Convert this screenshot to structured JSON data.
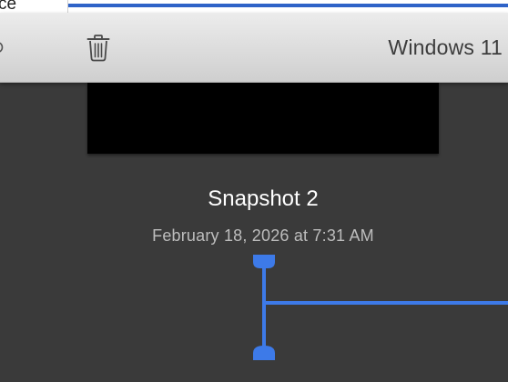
{
  "background_window": {
    "fragment_text": "ce"
  },
  "toolbar": {
    "title": "Windows 11",
    "left_icon": "circle-icon",
    "delete_icon": "trash-icon"
  },
  "snapshot": {
    "name": "Snapshot 2",
    "date": "February 18, 2026 at 7:31 AM"
  },
  "colors": {
    "timeline_accent": "#3d7ae8",
    "window_background": "#3a3a3a",
    "thumbnail": "#000000"
  }
}
